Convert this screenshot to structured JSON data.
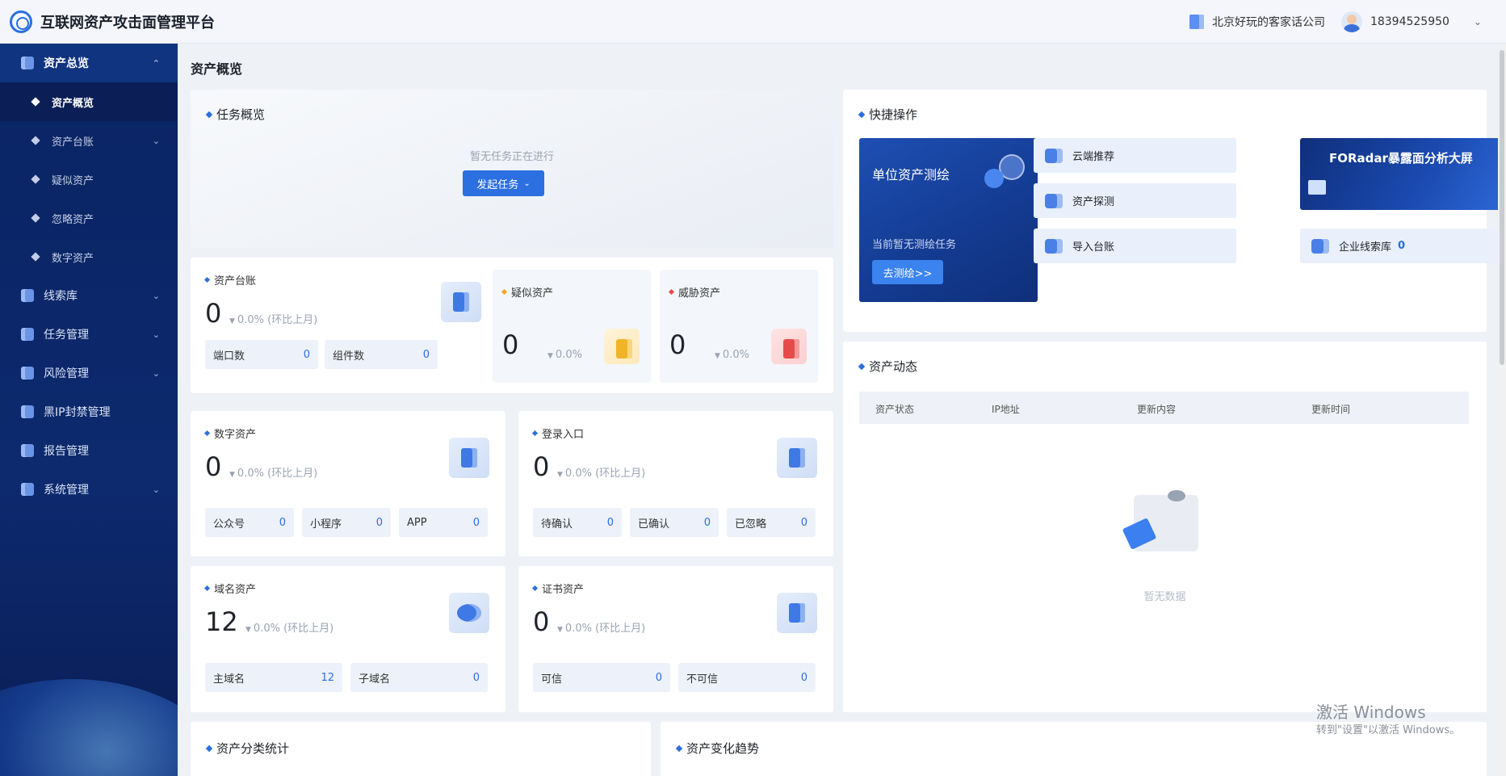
{
  "app": {
    "title": "互联网资产攻击面管理平台"
  },
  "header": {
    "company": "北京好玩的客家话公司",
    "user": "18394525950"
  },
  "sidebar": {
    "items": [
      {
        "label": "资产总览"
      },
      {
        "label": "线索库"
      },
      {
        "label": "任务管理"
      },
      {
        "label": "风险管理"
      },
      {
        "label": "黑IP封禁管理"
      },
      {
        "label": "报告管理"
      },
      {
        "label": "系统管理"
      }
    ],
    "sub": [
      {
        "label": "资产概览"
      },
      {
        "label": "资产台账"
      },
      {
        "label": "疑似资产"
      },
      {
        "label": "忽略资产"
      },
      {
        "label": "数字资产"
      }
    ]
  },
  "page": {
    "title": "资产概览"
  },
  "task": {
    "title": "任务概览",
    "empty": "暂无任务正在进行",
    "button": "发起任务"
  },
  "ledger": {
    "title": "资产台账",
    "value": "0",
    "trend": "0.0% (环比上月)",
    "pills": [
      {
        "label": "端口数",
        "value": "0"
      },
      {
        "label": "组件数",
        "value": "0"
      }
    ]
  },
  "suspect": {
    "title": "疑似资产",
    "value": "0",
    "trend": "0.0%"
  },
  "threat": {
    "title": "威胁资产",
    "value": "0",
    "trend": "0.0%"
  },
  "digital": {
    "title": "数字资产",
    "value": "0",
    "trend": "0.0% (环比上月)",
    "pills": [
      {
        "label": "公众号",
        "value": "0"
      },
      {
        "label": "小程序",
        "value": "0"
      },
      {
        "label": "APP",
        "value": "0"
      }
    ]
  },
  "login": {
    "title": "登录入口",
    "value": "0",
    "trend": "0.0% (环比上月)",
    "pills": [
      {
        "label": "待确认",
        "value": "0"
      },
      {
        "label": "已确认",
        "value": "0"
      },
      {
        "label": "已忽略",
        "value": "0"
      }
    ]
  },
  "domain": {
    "title": "域名资产",
    "value": "12",
    "trend": "0.0% (环比上月)",
    "pills": [
      {
        "label": "主域名",
        "value": "12"
      },
      {
        "label": "子域名",
        "value": "0"
      }
    ]
  },
  "cert": {
    "title": "证书资产",
    "value": "0",
    "trend": "0.0% (环比上月)",
    "pills": [
      {
        "label": "可信",
        "value": "0"
      },
      {
        "label": "不可信",
        "value": "0"
      }
    ]
  },
  "quick": {
    "title": "快捷操作",
    "measure": {
      "title": "单位资产测绘",
      "sub": "当前暂无测绘任务",
      "button": "去测绘>>"
    },
    "buttons": [
      {
        "label": "云端推荐"
      },
      {
        "label": "资产探测"
      },
      {
        "label": "导入台账"
      }
    ],
    "screen": "FORadar暴露面分析大屏",
    "clue": {
      "label": "企业线索库",
      "value": "0"
    }
  },
  "dynamics": {
    "title": "资产动态",
    "columns": [
      "资产状态",
      "IP地址",
      "更新内容",
      "更新时间"
    ],
    "empty": "暂无数据"
  },
  "bottom": {
    "left": "资产分类统计",
    "right": "资产变化趋势"
  },
  "watermark": {
    "line1": "激活 Windows",
    "line2": "转到\"设置\"以激活 Windows。"
  }
}
